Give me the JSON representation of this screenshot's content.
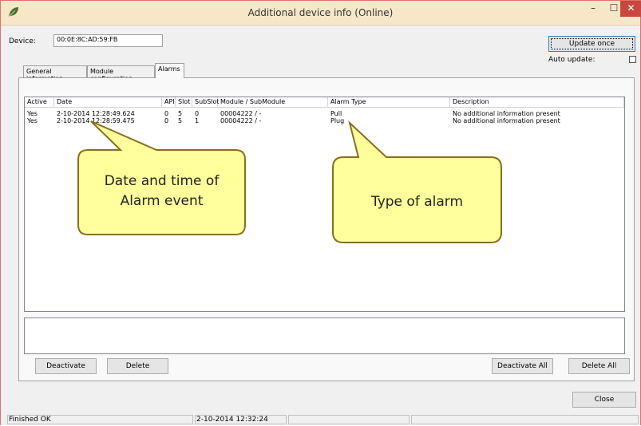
{
  "window": {
    "title": "Additional device info (Online)"
  },
  "device": {
    "label": "Device:",
    "value": "00:0E:8C:AD:59:FB"
  },
  "update_once_label": "Update once",
  "auto_update_label": "Auto update:",
  "tabs": [
    {
      "label": "General information"
    },
    {
      "label": "Module configuration"
    },
    {
      "label": "Alarms"
    }
  ],
  "alarm_table": {
    "columns": [
      "Active",
      "Date",
      "API",
      "Slot",
      "SubSlot",
      "Module / SubModule",
      "Alarm Type",
      "Description"
    ],
    "rows": [
      [
        "Yes",
        "2-10-2014 12:28:49.624",
        "0",
        "5",
        "0",
        "00004222 / -",
        "Pull",
        "No additional information present"
      ],
      [
        "Yes",
        "2-10-2014 12:28:59.475",
        "0",
        "5",
        "1",
        "00004222 / -",
        "Plug",
        "No additional information present"
      ]
    ]
  },
  "buttons": {
    "deactivate": "Deactivate",
    "delete": "Delete",
    "deactivate_all": "Deactivate All",
    "delete_all": "Delete All",
    "close": "Close"
  },
  "callouts": {
    "date": "Date and time of Alarm event",
    "type": "Type of alarm"
  },
  "status_bar": {
    "message": "Finished OK",
    "timestamp": "2-10-2014 12:32:24"
  },
  "colors": {
    "callout_fill": "#ffff9c",
    "callout_stroke": "#8a6d1e",
    "title_bar": "#f6e7c8",
    "close_button": "#c7483f"
  }
}
